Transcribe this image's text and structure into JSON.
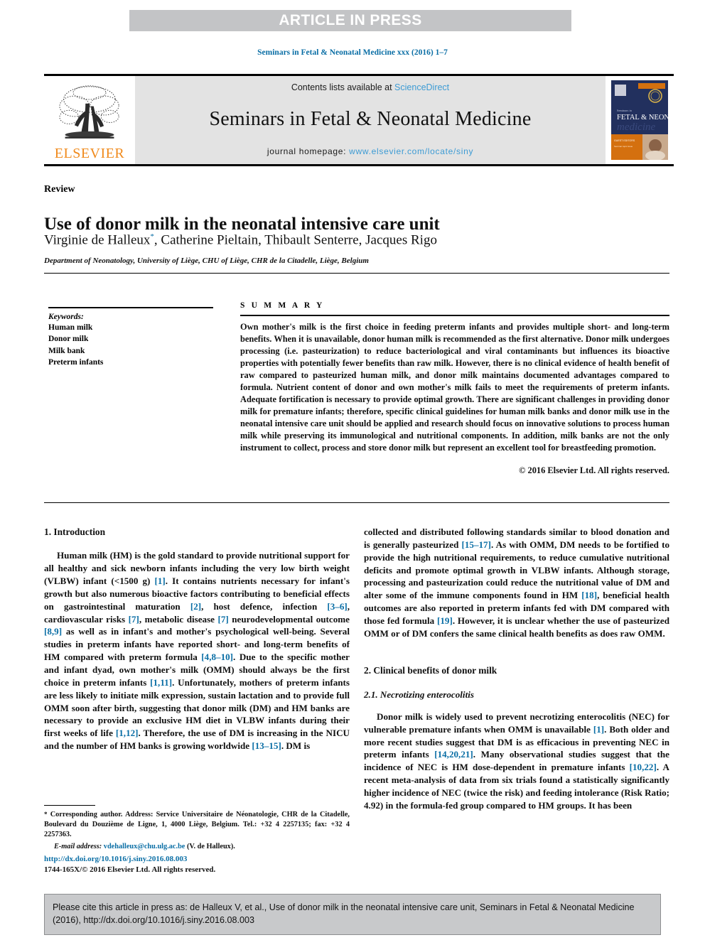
{
  "banner": {
    "label": "ARTICLE IN PRESS",
    "background": "#c3c4c6",
    "text_color": "#ffffff"
  },
  "running_head": "Seminars in Fetal & Neonatal Medicine xxx (2016) 1–7",
  "masthead": {
    "publisher_name": "ELSEVIER",
    "publisher_color": "#f08a1c",
    "contents_prefix": "Contents lists available at ",
    "contents_link": "ScienceDirect",
    "journal_title": "Seminars in Fetal & Neonatal Medicine",
    "homepage_prefix": "journal homepage: ",
    "homepage_url": "www.elsevier.com/locate/siny",
    "link_color": "#3d9bd4",
    "cover_title_line1": "FETAL & NEONATAL",
    "cover_title_line2": "medicine"
  },
  "article": {
    "type": "Review",
    "title": "Use of donor milk in the neonatal intensive care unit",
    "authors": "Virginie de Halleux",
    "corresponding_marker": "*",
    "authors_rest": ", Catherine Pieltain, Thibault Senterre, Jacques Rigo",
    "affiliation": "Department of Neonatology, University of Liège, CHU of Liège, CHR de la Citadelle, Liège, Belgium"
  },
  "keywords": {
    "heading": "Keywords:",
    "items": [
      "Human milk",
      "Donor milk",
      "Milk bank",
      "Preterm infants"
    ]
  },
  "summary": {
    "heading": "S U M M A R Y",
    "body": "Own mother's milk is the first choice in feeding preterm infants and provides multiple short- and long-term benefits. When it is unavailable, donor human milk is recommended as the first alternative. Donor milk undergoes processing (i.e. pasteurization) to reduce bacteriological and viral contaminants but influences its bioactive properties with potentially fewer benefits than raw milk. However, there is no clinical evidence of health benefit of raw compared to pasteurized human milk, and donor milk maintains documented advantages compared to formula. Nutrient content of donor and own mother's milk fails to meet the requirements of preterm infants. Adequate fortification is necessary to provide optimal growth. There are significant challenges in providing donor milk for premature infants; therefore, specific clinical guidelines for human milk banks and donor milk use in the neonatal intensive care unit should be applied and research should focus on innovative solutions to process human milk while preserving its immunological and nutritional components. In addition, milk banks are not the only instrument to collect, process and store donor milk but represent an excellent tool for breastfeeding promotion.",
    "copyright": "© 2016 Elsevier Ltd. All rights reserved."
  },
  "body": {
    "left": {
      "section1_heading": "1. Introduction",
      "para1_a": "Human milk (HM) is the gold standard to provide nutritional support for all healthy and sick newborn infants including the very low birth weight (VLBW) infant (<1500 g) ",
      "para1_r1": "[1]",
      "para1_b": ". It contains nutrients necessary for infant's growth but also numerous bioactive factors contributing to beneficial effects on gastrointestinal maturation ",
      "para1_r2": "[2]",
      "para1_c": ", host defence, infection ",
      "para1_r3": "[3–6]",
      "para1_d": ", cardiovascular risks ",
      "para1_r4": "[7]",
      "para1_e": ", metabolic disease ",
      "para1_r5": "[7]",
      "para1_f": " neurodevelopmental outcome ",
      "para1_r6": "[8,9]",
      "para1_g": " as well as in infant's and mother's psychological well-being. Several studies in preterm infants have reported short- and long-term benefits of HM compared with preterm formula ",
      "para1_r7": "[4,8–10]",
      "para1_h": ". Due to the specific mother and infant dyad, own mother's milk (OMM) should always be the first choice in preterm infants ",
      "para1_r8": "[1,11]",
      "para1_i": ". Unfortunately, mothers of preterm infants are less likely to initiate milk expression, sustain lactation and to provide full OMM soon after birth, suggesting that donor milk (DM) and HM banks are necessary to provide an exclusive HM diet in VLBW infants during their first weeks of life ",
      "para1_r9": "[1,12]",
      "para1_j": ". Therefore, the use of DM is increasing in the NICU and the number of HM banks is growing worldwide ",
      "para1_r10": "[13–15]",
      "para1_k": ". DM is"
    },
    "right": {
      "para_cont_a": "collected and distributed following standards similar to blood donation and is generally pasteurized ",
      "para_cont_r1": "[15–17]",
      "para_cont_b": ". As with OMM, DM needs to be fortified to provide the high nutritional requirements, to reduce cumulative nutritional deficits and promote optimal growth in VLBW infants. Although storage, processing and pasteurization could reduce the nutritional value of DM and alter some of the immune components found in HM ",
      "para_cont_r2": "[18]",
      "para_cont_c": ", beneficial health outcomes are also reported in preterm infants fed with DM compared with those fed formula ",
      "para_cont_r3": "[19]",
      "para_cont_d": ". However, it is unclear whether the use of pasteurized OMM or of DM confers the same clinical health benefits as does raw OMM.",
      "section2_heading": "2. Clinical benefits of donor milk",
      "subsection21_heading": "2.1. Necrotizing enterocolitis",
      "para2_a": "Donor milk is widely used to prevent necrotizing enterocolitis (NEC) for vulnerable premature infants when OMM is unavailable ",
      "para2_r1": "[1]",
      "para2_b": ". Both older and more recent studies suggest that DM is as efficacious in preventing NEC in preterm infants ",
      "para2_r2": "[14,20,21]",
      "para2_c": ". Many observational studies suggest that the incidence of NEC is HM dose-dependent in premature infants ",
      "para2_r3": "[10,22]",
      "para2_d": ". A recent meta-analysis of data from six trials found a statistically significantly higher incidence of NEC (twice the risk) and feeding intolerance (Risk Ratio; 4.92) in the formula-fed group compared to HM groups. It has been"
    }
  },
  "footnote": {
    "star": "*",
    "text": " Corresponding author. Address: Service Universitaire de Néonatologie, CHR de la Citadelle, Boulevard du Douzième de Ligne, 1, 4000 Liège, Belgium. Tel.: +32 4 2257135; fax: +32 4 2257363.",
    "email_label": "E-mail address:",
    "email": "vdehalleux@chu.ulg.ac.be",
    "email_suffix": " (V. de Halleux)."
  },
  "doi_block": {
    "doi": "http://dx.doi.org/10.1016/j.siny.2016.08.003",
    "issn_line": "1744-165X/© 2016 Elsevier Ltd. All rights reserved."
  },
  "citation_box": {
    "text": "Please cite this article in press as: de Halleux V, et al., Use of donor milk in the neonatal intensive care unit, Seminars in Fetal & Neonatal Medicine (2016), http://dx.doi.org/10.1016/j.siny.2016.08.003",
    "background": "#c8c9cb"
  }
}
